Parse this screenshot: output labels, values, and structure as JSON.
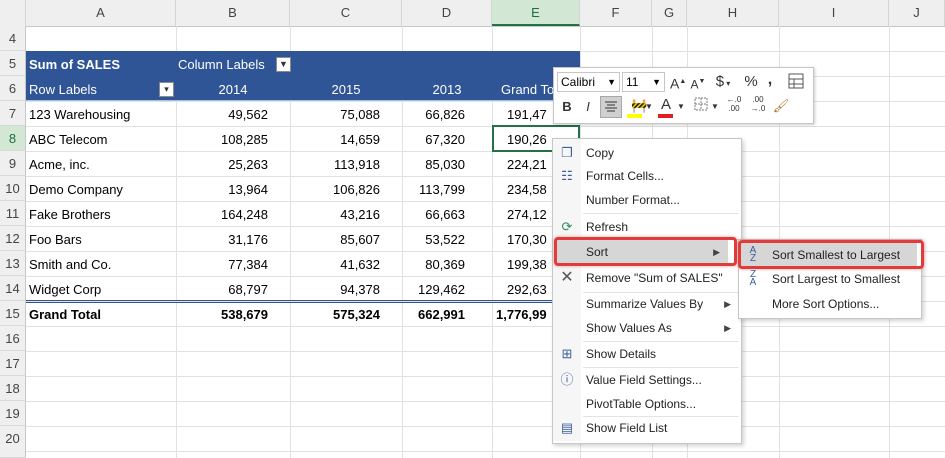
{
  "columns": [
    "A",
    "B",
    "C",
    "D",
    "E",
    "F",
    "G",
    "H",
    "I",
    "J"
  ],
  "rows": [
    "4",
    "5",
    "6",
    "7",
    "8",
    "9",
    "10",
    "11",
    "12",
    "13",
    "14",
    "15",
    "16",
    "17",
    "18",
    "19",
    "20"
  ],
  "pivot": {
    "header1_left": "Sum of SALES",
    "header1_right": "Column Labels",
    "row_labels": "Row Labels",
    "years": [
      "2014",
      "2015",
      "2013"
    ],
    "grand_total_col": "Grand To",
    "data": [
      {
        "label": "123 Warehousing",
        "v": [
          "49,562",
          "75,088",
          "66,826"
        ],
        "gt": "191,47"
      },
      {
        "label": "ABC Telecom",
        "v": [
          "108,285",
          "14,659",
          "67,320"
        ],
        "gt": "190,26"
      },
      {
        "label": "Acme, inc.",
        "v": [
          "25,263",
          "113,918",
          "85,030"
        ],
        "gt": "224,21"
      },
      {
        "label": "Demo Company",
        "v": [
          "13,964",
          "106,826",
          "113,799"
        ],
        "gt": "234,58"
      },
      {
        "label": "Fake Brothers",
        "v": [
          "164,248",
          "43,216",
          "66,663"
        ],
        "gt": "274,12"
      },
      {
        "label": "Foo Bars",
        "v": [
          "31,176",
          "85,607",
          "53,522"
        ],
        "gt": "170,30"
      },
      {
        "label": "Smith and Co.",
        "v": [
          "77,384",
          "41,632",
          "80,369"
        ],
        "gt": "199,38"
      },
      {
        "label": "Widget Corp",
        "v": [
          "68,797",
          "94,378",
          "129,462"
        ],
        "gt": "292,63"
      }
    ],
    "grand_total": {
      "label": "Grand Total",
      "v": [
        "538,679",
        "575,324",
        "662,991"
      ],
      "gt": "1,776,99"
    }
  },
  "mini_toolbar": {
    "font": "Calibri",
    "size": "11",
    "grow": "A",
    "shrink": "A",
    "currency": "$",
    "percent": "%",
    "comma": ",",
    "bold": "B",
    "italic": "I",
    "inc_decimal": "←.0\n.00",
    "dec_decimal": ".00\n→.0",
    "font_color_letter": "A"
  },
  "context_menu": {
    "items": {
      "copy": "Copy",
      "format_cells": "Format Cells...",
      "number_format": "Number Format...",
      "refresh": "Refresh",
      "sort": "Sort",
      "remove": "Remove \"Sum of SALES\"",
      "summarize": "Summarize Values By",
      "show_values": "Show Values As",
      "show_details": "Show Details",
      "value_field": "Value Field Settings...",
      "pivot_options": "PivotTable Options...",
      "field_list": "Show Field List"
    }
  },
  "sort_submenu": {
    "asc": "Sort Smallest to Largest",
    "desc": "Sort Largest to Smallest",
    "more": "More Sort Options..."
  },
  "colors": {
    "pivot_header": "#2f5597",
    "highlight": "#e03c3c",
    "selected_header": "#d3e7d5",
    "menu_hover": "#d6d6d6"
  }
}
